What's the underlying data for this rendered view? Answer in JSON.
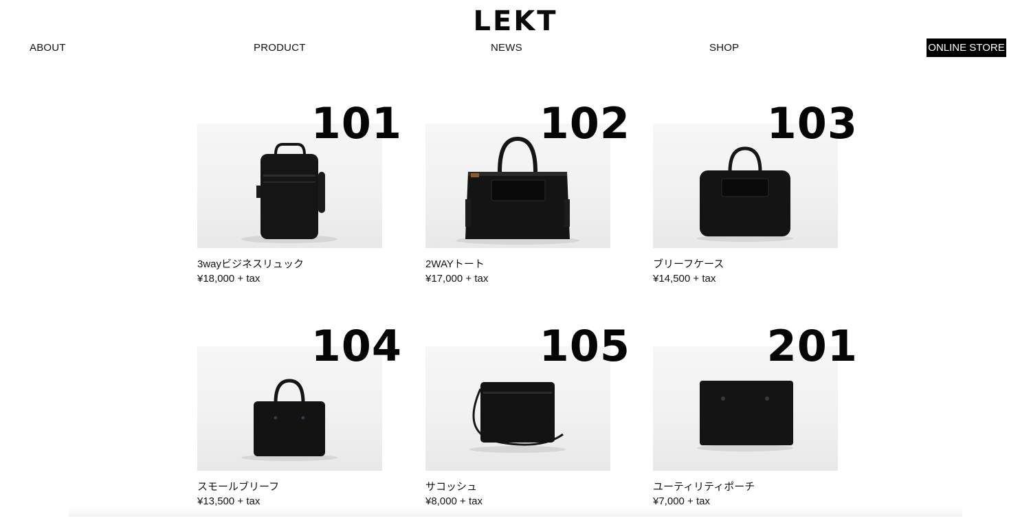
{
  "brand": {
    "logo": "LEKT"
  },
  "nav": {
    "about": "ABOUT",
    "product": "PRODUCT",
    "news": "NEWS",
    "shop": "SHOP",
    "online_store": "ONLINE STORE"
  },
  "products": [
    {
      "number": "101",
      "name": "3wayビジネスリュック",
      "price": "¥18,000 + tax",
      "image_icon": "backpack-photo"
    },
    {
      "number": "102",
      "name": "2WAYトート",
      "price": "¥17,000 + tax",
      "image_icon": "tote-bag-photo"
    },
    {
      "number": "103",
      "name": "ブリーフケース",
      "price": "¥14,500 + tax",
      "image_icon": "briefcase-photo"
    },
    {
      "number": "104",
      "name": "スモールブリーフ",
      "price": "¥13,500 + tax",
      "image_icon": "small-brief-photo"
    },
    {
      "number": "105",
      "name": "サコッシュ",
      "price": "¥8,000 + tax",
      "image_icon": "sacoche-photo"
    },
    {
      "number": "201",
      "name": "ユーティリティポーチ",
      "price": "¥7,000 + tax",
      "image_icon": "pouch-photo"
    }
  ],
  "colors": {
    "text": "#111111",
    "store_button_bg": "#000000",
    "store_button_text": "#ffffff",
    "photo_bg": "#f1f1f1",
    "bag": "#111111"
  }
}
